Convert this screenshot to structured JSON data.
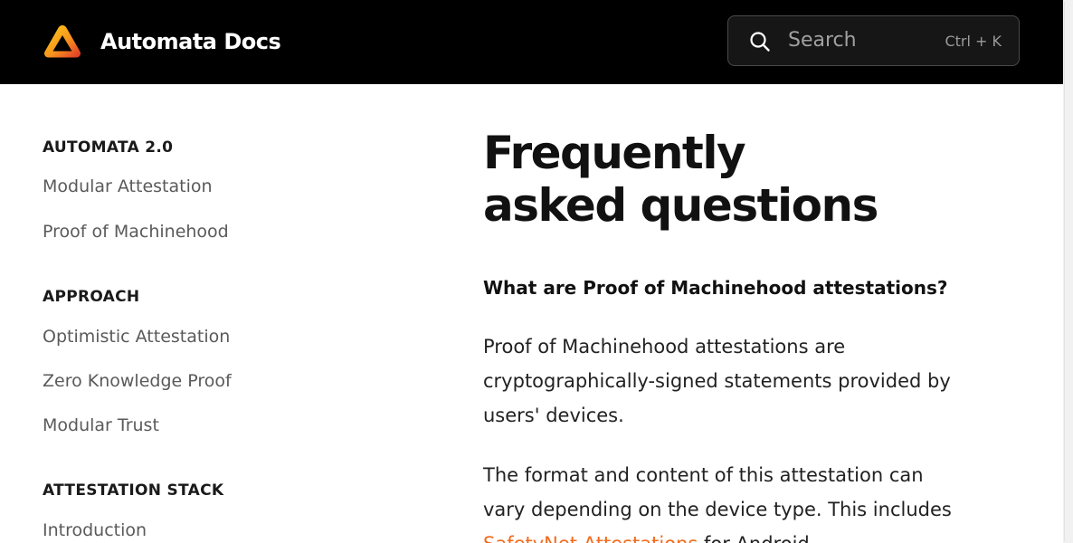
{
  "header": {
    "logo_icon": "automata-triangle-logo-icon",
    "brand_name": "Automata Docs",
    "search": {
      "placeholder": "Search",
      "shortcut": "Ctrl + K",
      "icon": "search-icon"
    },
    "background_color": "#000000"
  },
  "sidebar": {
    "sections": [
      {
        "title": "AUTOMATA 2.0",
        "items": [
          "Modular Attestation",
          "Proof of Machinehood"
        ]
      },
      {
        "title": "APPROACH",
        "items": [
          "Optimistic Attestation",
          "Zero Knowledge Proof",
          "Modular Trust"
        ]
      },
      {
        "title": "ATTESTATION STACK",
        "items": [
          "Introduction"
        ]
      }
    ]
  },
  "main": {
    "title_line1": "Frequently",
    "title_line2": "asked questions",
    "question": "What are Proof of Machinehood attestations?",
    "answer_p1": "Proof of Machinehood attestations are cryptographically-signed statements provided by users' devices.",
    "answer_p2_before": "The format and content of this attestation can vary depending on the device type. This includes ",
    "answer_p2_link": "SafetyNet Attestations",
    "answer_p2_after": " for Android"
  },
  "colors": {
    "accent": "#f26b1d",
    "text": "#111111",
    "muted": "#5a5a5a"
  }
}
